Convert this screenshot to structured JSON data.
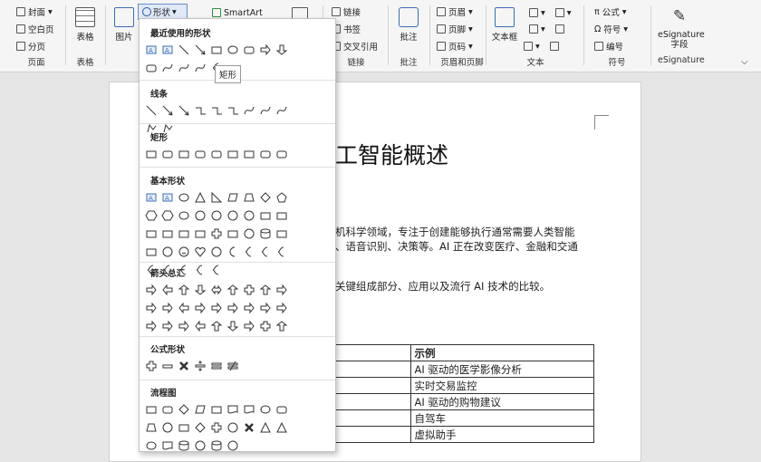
{
  "ribbon": {
    "cover": "封面",
    "blank": "空白页",
    "pagebreak": "分页",
    "pages_group": "页面",
    "table": "表格",
    "tables_group": "表格",
    "pictures": "图片",
    "shapes": "形状",
    "smartart": "SmartArt",
    "link": "链接",
    "bookmark": "书签",
    "crossref": "交叉引用",
    "links_group": "链接",
    "comment": "批注",
    "comments_group": "批注",
    "header": "页眉",
    "footer": "页脚",
    "pagenum": "页码",
    "hf_group": "页眉和页脚",
    "textbox": "文本框",
    "text_group": "文本",
    "equation": "公式",
    "symbol": "符号",
    "number": "编号",
    "symbols_group": "符号",
    "esig": "eSignature 字段",
    "esig_group": "eSignature"
  },
  "document": {
    "title": "工智能概述",
    "para1": "机科学领域，专注于创建能够执行通常需要人类智能",
    "para2": "、语音识别、决策等。AI 正在改变医疗、金融和交通",
    "para3": "关键组成部分、应用以及流行 AI 技术的比较。",
    "table": {
      "header": "示例",
      "rows": [
        "AI 驱动的医学影像分析",
        "实时交易监控",
        "AI 驱动的购物建议",
        "自驾车",
        "虚拟助手"
      ]
    }
  },
  "shapes_menu": {
    "recent": "最近使用的形状",
    "lines": "线条",
    "rectangles": "矩形",
    "basic": "基本形状",
    "arrows": "箭头总汇",
    "equation": "公式形状",
    "flowchart": "流程图",
    "tooltip": "矩形"
  }
}
